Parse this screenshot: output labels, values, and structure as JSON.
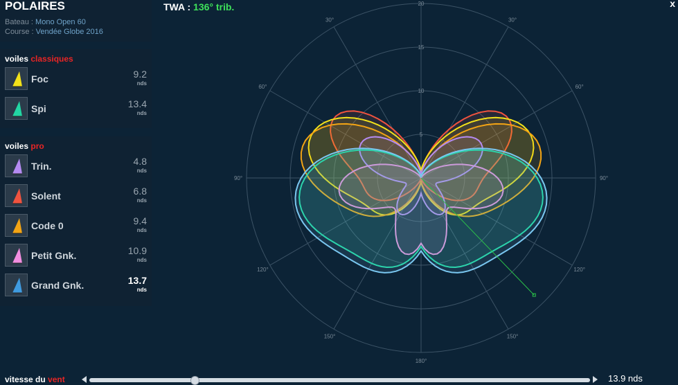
{
  "header": {
    "title": "POLAIRES",
    "boat_label": "Bateau : ",
    "boat_value": "Mono Open 60",
    "race_label": "Course : ",
    "race_value": "Vendée Globe 2016"
  },
  "classic": {
    "title_prefix": "voiles ",
    "title_accent": "classiques",
    "sails": [
      {
        "name": "Foc",
        "speed": "9.2",
        "unit": "nds",
        "color": "#f3e21a"
      },
      {
        "name": "Spi",
        "speed": "13.4",
        "unit": "nds",
        "color": "#22d6a3"
      }
    ]
  },
  "pro": {
    "title_prefix": "voiles ",
    "title_accent": "pro",
    "sails": [
      {
        "name": "Trin.",
        "speed": "4.8",
        "unit": "nds",
        "color": "#b58bf2"
      },
      {
        "name": "Solent",
        "speed": "6.8",
        "unit": "nds",
        "color": "#f0533f"
      },
      {
        "name": "Code 0",
        "speed": "9.4",
        "unit": "nds",
        "color": "#f3a414"
      },
      {
        "name": "Petit Gnk.",
        "speed": "10.9",
        "unit": "nds",
        "color": "#f28ee0"
      },
      {
        "name": "Grand Gnk.",
        "speed": "13.7",
        "unit": "nds",
        "color": "#3f9be0"
      }
    ]
  },
  "twa": {
    "label": "TWA : ",
    "value": "136° trib."
  },
  "close_label": "x",
  "polar": {
    "angle_labels": [
      "30°",
      "30°",
      "60°",
      "60°",
      "90°",
      "90°",
      "120°",
      "120°",
      "150°",
      "150°",
      "180°"
    ],
    "speed_labels": [
      "5",
      "10",
      "15",
      "20"
    ]
  },
  "wind": {
    "label_prefix": "vitesse du ",
    "label_accent": "vent",
    "value": "13.9 nds",
    "slider_fraction": 0.21
  },
  "colors": {
    "accent_red": "#e82525",
    "twa_green": "#3ee05a",
    "background": "#0c2336",
    "panel": "#0f2233"
  },
  "icons": [
    "sail-icon",
    "close-icon",
    "arrow-left-icon",
    "arrow-right-icon",
    "slider-thumb"
  ]
}
